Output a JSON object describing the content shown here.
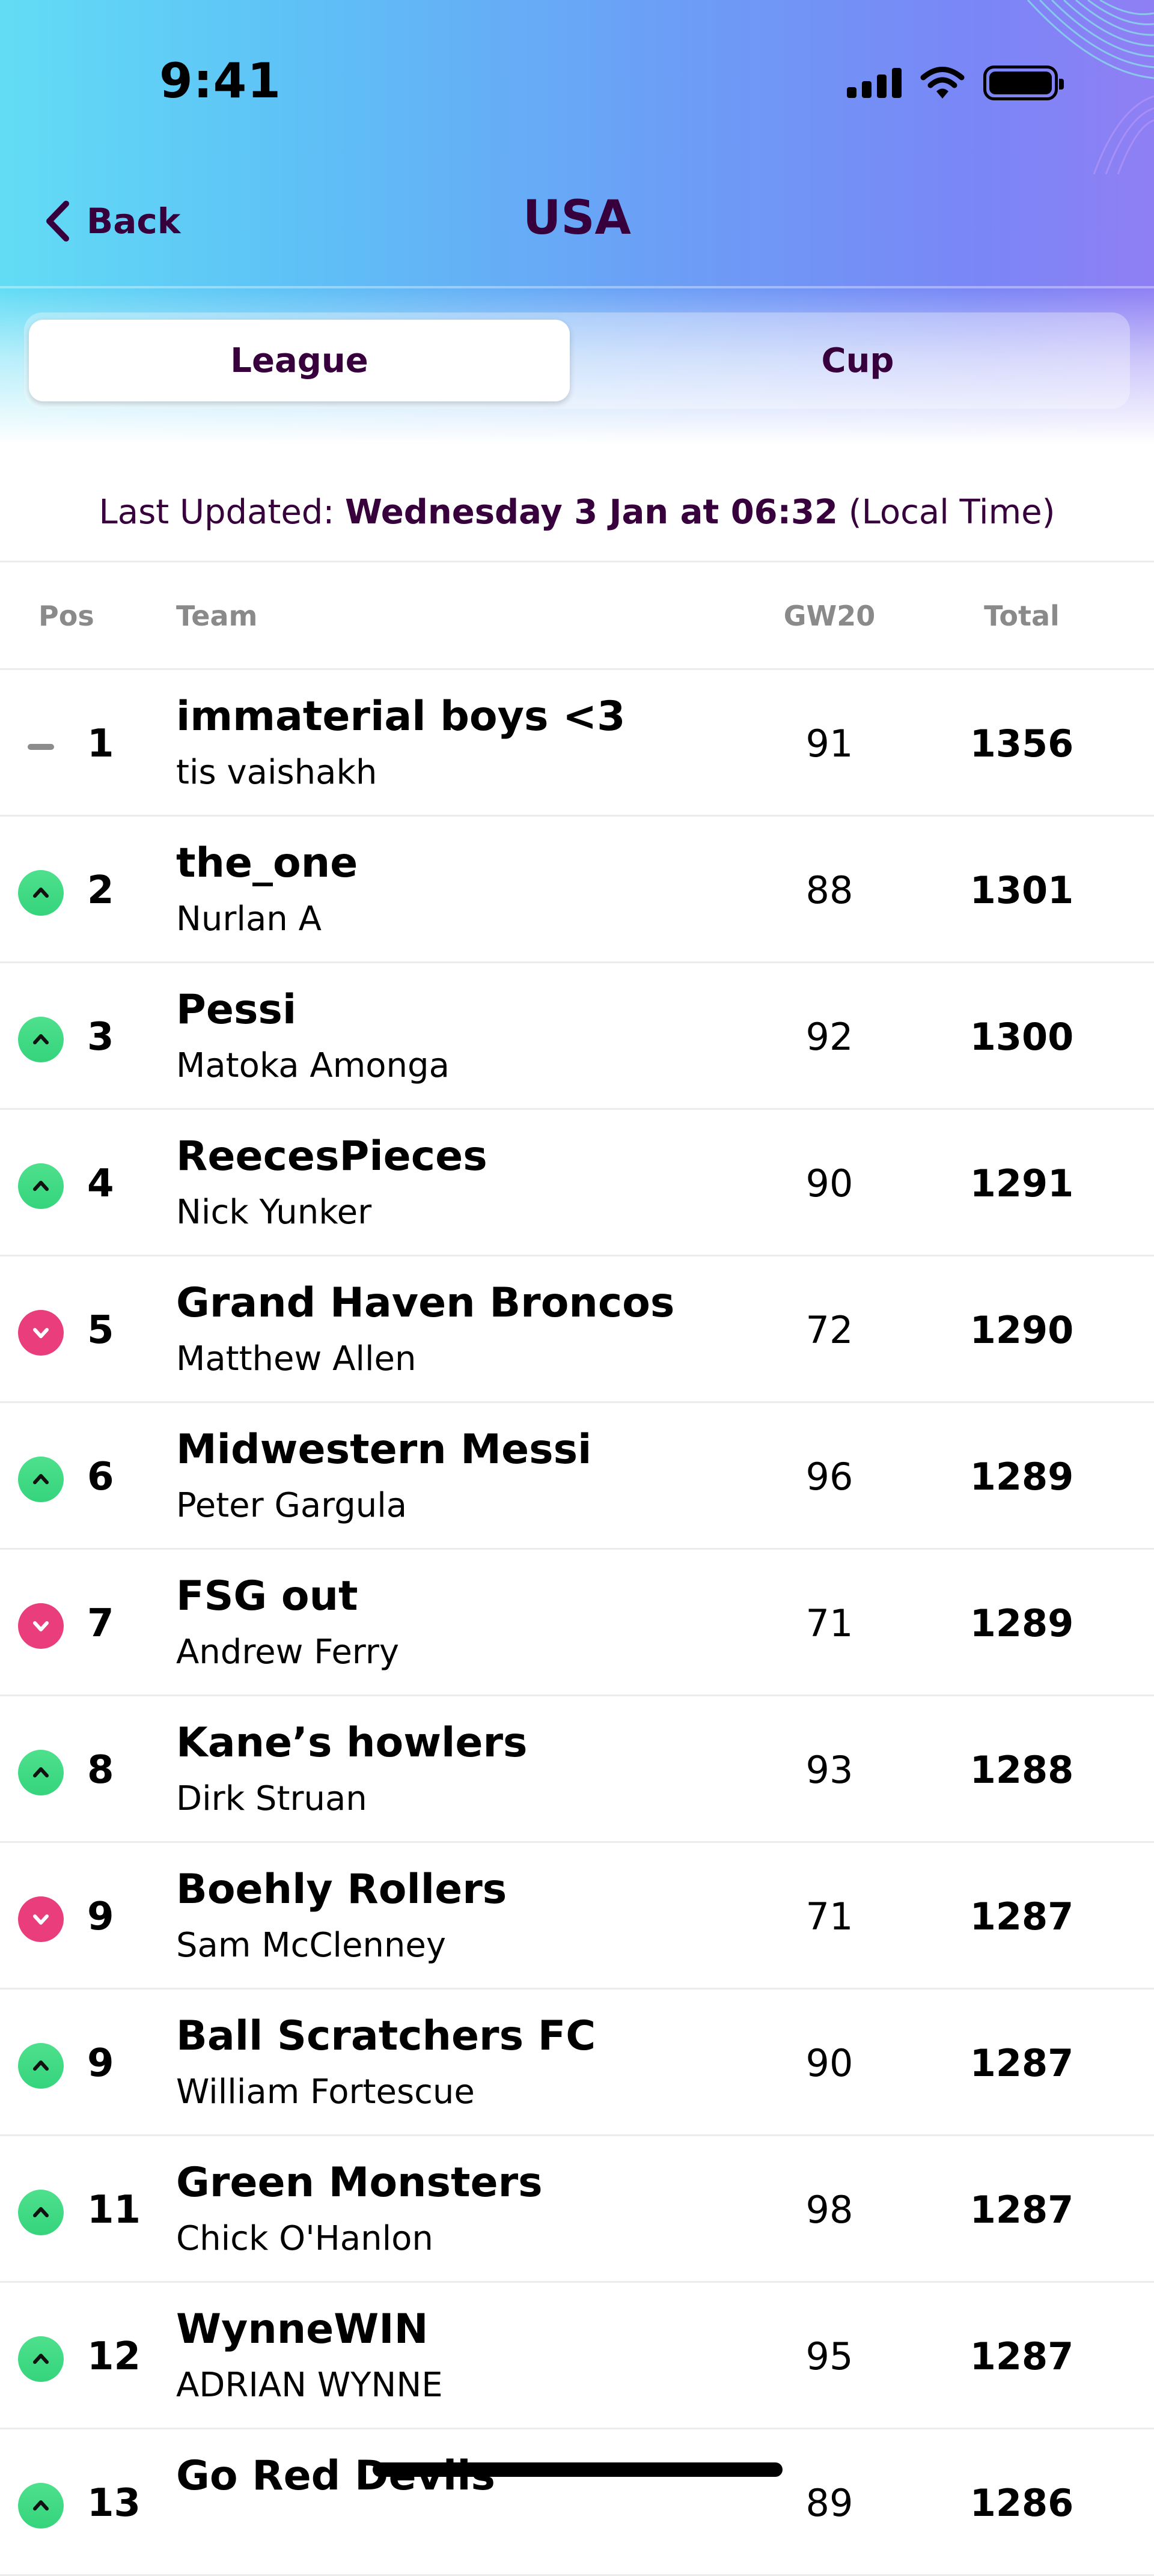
{
  "status_bar": {
    "time": "9:41"
  },
  "nav": {
    "back_label": "Back",
    "title": "USA"
  },
  "tabs": [
    {
      "label": "League",
      "selected": true
    },
    {
      "label": "Cup",
      "selected": false
    }
  ],
  "last_updated": {
    "prefix": "Last Updated: ",
    "value": "Wednesday 3 Jan at 06:32",
    "suffix": " (Local Time)"
  },
  "table": {
    "headers": {
      "pos": "Pos",
      "team": "Team",
      "gw": "GW20",
      "total": "Total"
    },
    "rows": [
      {
        "movement": "same",
        "pos": "1",
        "team": "immaterial boys <3",
        "manager": "tis vaishakh",
        "gw": "91",
        "total": "1356"
      },
      {
        "movement": "up",
        "pos": "2",
        "team": "the_one",
        "manager": "Nurlan A",
        "gw": "88",
        "total": "1301"
      },
      {
        "movement": "up",
        "pos": "3",
        "team": "Pessi",
        "manager": "Matoka Amonga",
        "gw": "92",
        "total": "1300"
      },
      {
        "movement": "up",
        "pos": "4",
        "team": "ReecesPieces",
        "manager": "Nick Yunker",
        "gw": "90",
        "total": "1291"
      },
      {
        "movement": "down",
        "pos": "5",
        "team": "Grand Haven Broncos",
        "manager": "Matthew Allen",
        "gw": "72",
        "total": "1290"
      },
      {
        "movement": "up",
        "pos": "6",
        "team": "Midwestern Messi",
        "manager": "Peter Gargula",
        "gw": "96",
        "total": "1289"
      },
      {
        "movement": "down",
        "pos": "7",
        "team": "FSG out",
        "manager": "Andrew Ferry",
        "gw": "71",
        "total": "1289"
      },
      {
        "movement": "up",
        "pos": "8",
        "team": "Kane’s howlers",
        "manager": "Dirk Struan",
        "gw": "93",
        "total": "1288"
      },
      {
        "movement": "down",
        "pos": "9",
        "team": "Boehly Rollers",
        "manager": "Sam McClenney",
        "gw": "71",
        "total": "1287"
      },
      {
        "movement": "up",
        "pos": "9",
        "team": "Ball Scratchers FC",
        "manager": "William Fortescue",
        "gw": "90",
        "total": "1287"
      },
      {
        "movement": "up",
        "pos": "11",
        "team": "Green Monsters",
        "manager": "Chick O'Hanlon",
        "gw": "98",
        "total": "1287"
      },
      {
        "movement": "up",
        "pos": "12",
        "team": "WynneWIN",
        "manager": "ADRIAN WYNNE",
        "gw": "95",
        "total": "1287"
      },
      {
        "movement": "up",
        "pos": "13",
        "team": "Go Red Devils",
        "manager": "",
        "gw": "89",
        "total": "1286"
      }
    ]
  },
  "colors": {
    "brand_purple": "#37003c",
    "up_green": "#35d47c",
    "down_pink": "#ea3e7c",
    "neutral_grey": "#8c8c8c"
  }
}
